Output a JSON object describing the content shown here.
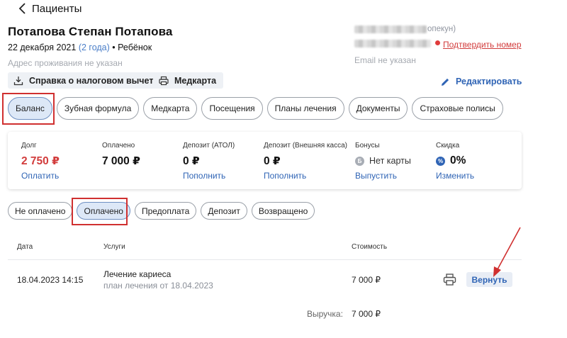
{
  "header": {
    "title": "Пациенты"
  },
  "patient": {
    "name": "Потапова Степан Потапова",
    "dob": "22 декабря 2021",
    "age": "(2 года)",
    "type": "• Ребёнок",
    "address": "Адрес проживания не указан"
  },
  "contacts": {
    "guardian_suffix": "опекун)",
    "confirm_phone": "Подтвердить номер",
    "email": "Email не указан"
  },
  "actions": {
    "tax_certificate": "Справка о налоговом вычете",
    "medcard": "Медкарта",
    "edit": "Редактировать"
  },
  "tabs": [
    {
      "label": "Баланс",
      "active": true
    },
    {
      "label": "Зубная формула"
    },
    {
      "label": "Медкарта"
    },
    {
      "label": "Посещения"
    },
    {
      "label": "Планы лечения"
    },
    {
      "label": "Документы"
    },
    {
      "label": "Страховые полисы"
    }
  ],
  "balance": {
    "debt": {
      "label": "Долг",
      "value": "2 750 ₽",
      "link": "Оплатить"
    },
    "paid": {
      "label": "Оплачено",
      "value": "7 000 ₽"
    },
    "deposit_atol": {
      "label": "Депозит (АТОЛ)",
      "value": "0 ₽",
      "link": "Пополнить"
    },
    "deposit_ext": {
      "label": "Депозит (Внешняя касса)",
      "value": "0 ₽",
      "link": "Пополнить"
    },
    "bonuses": {
      "label": "Бонусы",
      "value": "Нет карты",
      "link": "Выпустить",
      "icon": "Б"
    },
    "discount": {
      "label": "Скидка",
      "value": "0%",
      "link": "Изменить",
      "icon": "%"
    }
  },
  "filters": [
    {
      "label": "Не оплачено"
    },
    {
      "label": "Оплачено",
      "active": true
    },
    {
      "label": "Предоплата"
    },
    {
      "label": "Депозит"
    },
    {
      "label": "Возвращено"
    }
  ],
  "table": {
    "headers": {
      "date": "Дата",
      "services": "Услуги",
      "cost": "Стоимость"
    },
    "rows": [
      {
        "date": "18.04.2023 14:15",
        "service": "Лечение кариеса",
        "plan": "план лечения от 18.04.2023",
        "cost": "7 000 ₽",
        "action": "Вернуть"
      }
    ],
    "revenue_label": "Выручка:",
    "revenue_value": "7 000 ₽"
  },
  "colors": {
    "accent": "#2f64b5",
    "danger": "#d23c3c",
    "active_bg": "#dde8f7",
    "highlight": "#d03030"
  }
}
